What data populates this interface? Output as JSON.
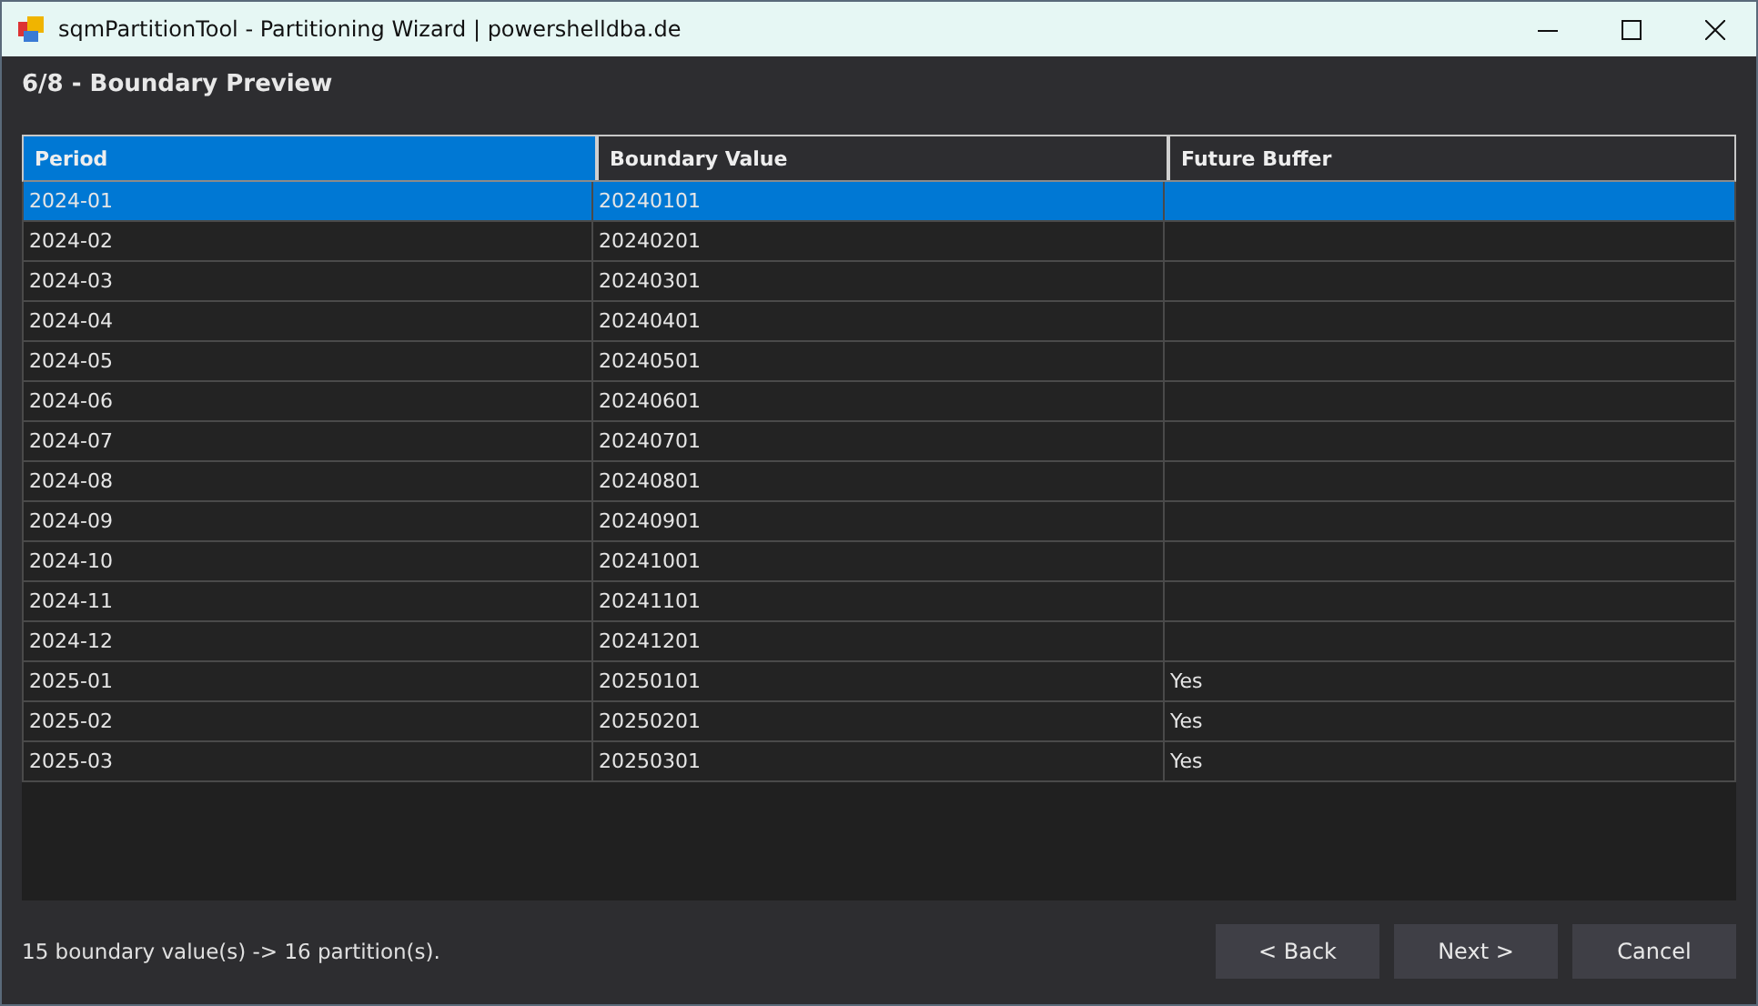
{
  "window": {
    "title": "sqmPartitionTool - Partitioning Wizard | powershelldba.de"
  },
  "step_title": "6/8 - Boundary Preview",
  "table": {
    "columns": [
      {
        "label": "Period",
        "selected": true
      },
      {
        "label": "Boundary Value",
        "selected": false
      },
      {
        "label": "Future Buffer",
        "selected": false
      }
    ],
    "rows": [
      {
        "cells": [
          "2024-01",
          "20240101",
          ""
        ],
        "selected": true
      },
      {
        "cells": [
          "2024-02",
          "20240201",
          ""
        ],
        "selected": false
      },
      {
        "cells": [
          "2024-03",
          "20240301",
          ""
        ],
        "selected": false
      },
      {
        "cells": [
          "2024-04",
          "20240401",
          ""
        ],
        "selected": false
      },
      {
        "cells": [
          "2024-05",
          "20240501",
          ""
        ],
        "selected": false
      },
      {
        "cells": [
          "2024-06",
          "20240601",
          ""
        ],
        "selected": false
      },
      {
        "cells": [
          "2024-07",
          "20240701",
          ""
        ],
        "selected": false
      },
      {
        "cells": [
          "2024-08",
          "20240801",
          ""
        ],
        "selected": false
      },
      {
        "cells": [
          "2024-09",
          "20240901",
          ""
        ],
        "selected": false
      },
      {
        "cells": [
          "2024-10",
          "20241001",
          ""
        ],
        "selected": false
      },
      {
        "cells": [
          "2024-11",
          "20241101",
          ""
        ],
        "selected": false
      },
      {
        "cells": [
          "2024-12",
          "20241201",
          ""
        ],
        "selected": false
      },
      {
        "cells": [
          "2025-01",
          "20250101",
          "Yes"
        ],
        "selected": false
      },
      {
        "cells": [
          "2025-02",
          "20250201",
          "Yes"
        ],
        "selected": false
      },
      {
        "cells": [
          "2025-03",
          "20250301",
          "Yes"
        ],
        "selected": false
      }
    ]
  },
  "status": "15 boundary value(s) -> 16 partition(s).",
  "buttons": [
    "< Back",
    "Next >",
    "Cancel"
  ]
}
